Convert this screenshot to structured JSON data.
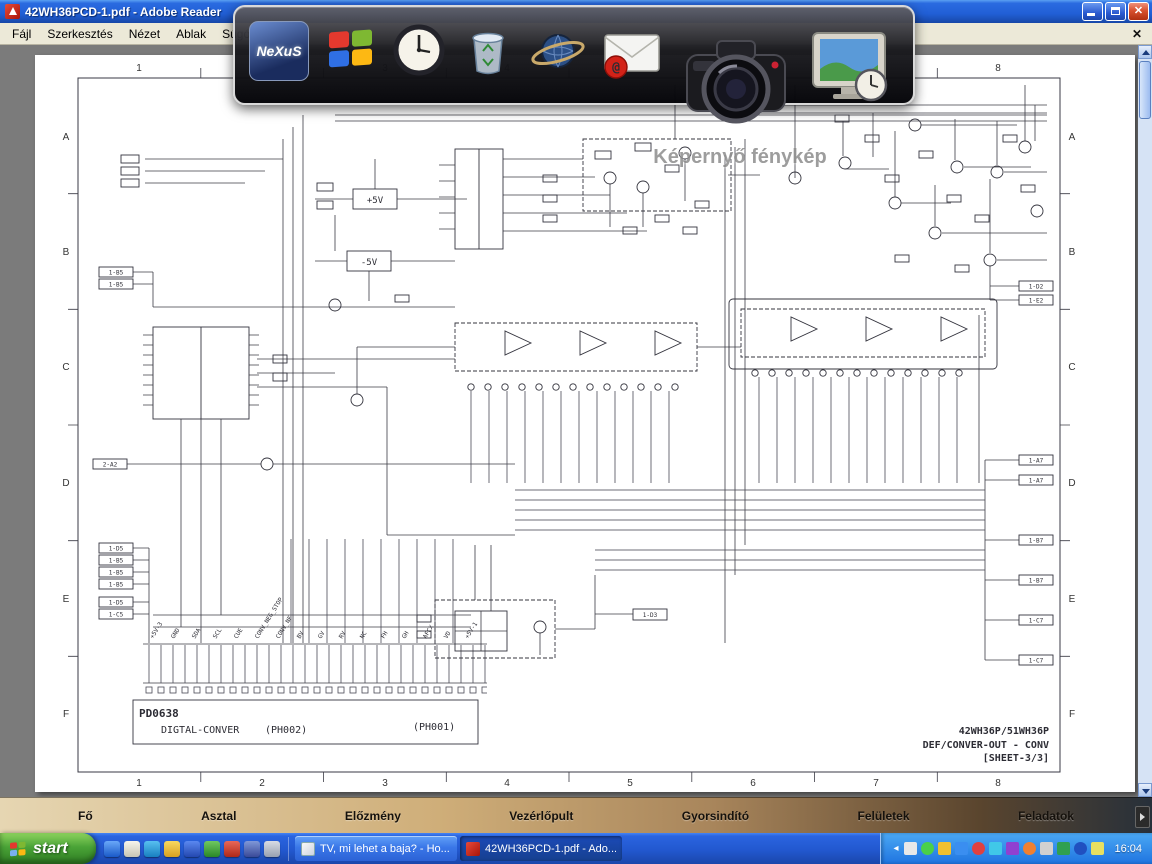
{
  "window": {
    "title": "42WH36PCD-1.pdf - Adobe Reader",
    "menu": [
      "Fájl",
      "Szerkesztés",
      "Nézet",
      "Ablak",
      "Súgó"
    ],
    "close_glyph": "✕"
  },
  "dock_top": {
    "nexus_text": "NeXuS",
    "mail_at": "@",
    "label": "Képernyő fénykép"
  },
  "schematic": {
    "grid_cols": [
      "1",
      "2",
      "3",
      "4",
      "5",
      "6",
      "7",
      "8"
    ],
    "grid_rows": [
      "A",
      "B",
      "C",
      "D",
      "E",
      "F"
    ],
    "reg_pos": "+5V",
    "reg_neg": "-5V",
    "board": "PD0638",
    "board_name": "DIGTAL-CONVER",
    "conn_left": "(PH002)",
    "conn_right": "(PH001)",
    "flag_a2": "2-A2",
    "flag_mid": "1-D3",
    "left_flags": [
      "1-B5",
      "1-B5",
      "1-D5",
      "1-B5",
      "1-B5",
      "1-B5",
      "1-D5",
      "1-C5"
    ],
    "right_flags": [
      "1-D2",
      "1-E2",
      "1-A7",
      "1-A7",
      "1-B7",
      "1-B7",
      "1-C7",
      "1-C7"
    ],
    "pin_labels": [
      "+5V-3",
      "GND",
      "SDA",
      "SCL",
      "CUE",
      "CONV_NEG_STOP",
      "CONV_NF",
      "BV",
      "GV",
      "RV",
      "NC",
      "FH",
      "GH",
      "AFCX",
      "VD",
      "+5V-1"
    ],
    "title_line1": "42WH36P/51WH36P",
    "title_line2": "DEF/CONVER-OUT - CONV",
    "title_line3": "[SHEET-3/3]"
  },
  "dockbar": {
    "tabs": [
      "Fő",
      "Asztal",
      "Előzmény",
      "Vezérlőpult",
      "Gyorsindító",
      "Felületek",
      "Feladatok"
    ]
  },
  "taskbar": {
    "start_label": "start",
    "tasks": [
      "TV, mi lehet a baja? - Ho...",
      "42WH36PCD-1.pdf - Ado..."
    ],
    "clock": "16:04"
  }
}
